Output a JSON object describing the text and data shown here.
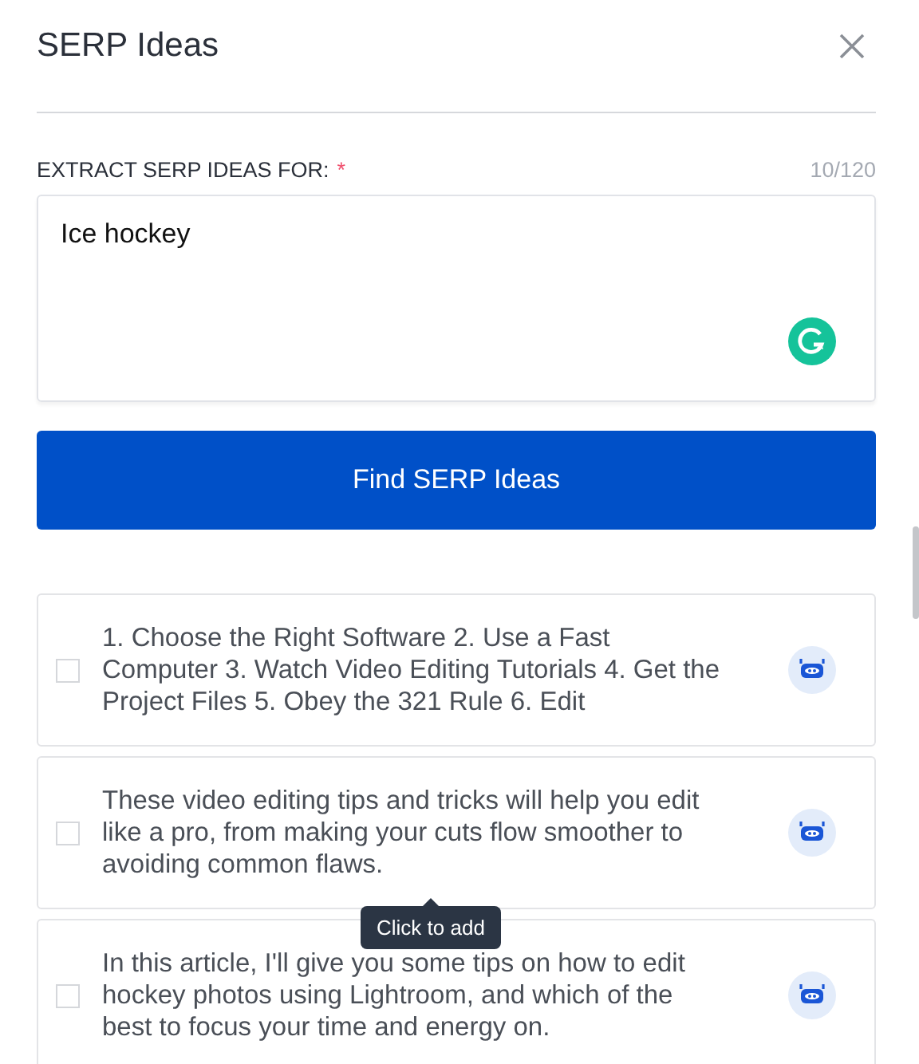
{
  "title": "SERP Ideas",
  "field": {
    "label": "EXTRACT SERP IDEAS FOR:",
    "required_mark": "*",
    "counter": "10/120",
    "value": "Ice hockey"
  },
  "button": "Find SERP Ideas",
  "ideas": [
    {
      "text": "1. Choose the Right Software 2. Use a Fast Computer 3. Watch Video Editing Tutorials 4. Get the Project Files 5. Obey the 321 Rule 6. Edit",
      "checked": false
    },
    {
      "text": "These video editing tips and tricks will help you edit like a pro, from making your cuts flow smoother to avoiding common flaws.",
      "checked": false
    },
    {
      "text": "In this article, I'll give you some tips on how to edit hockey photos using Lightroom, and which of the best to focus your time and energy on.",
      "checked": false
    }
  ],
  "tooltip": "Click to add"
}
